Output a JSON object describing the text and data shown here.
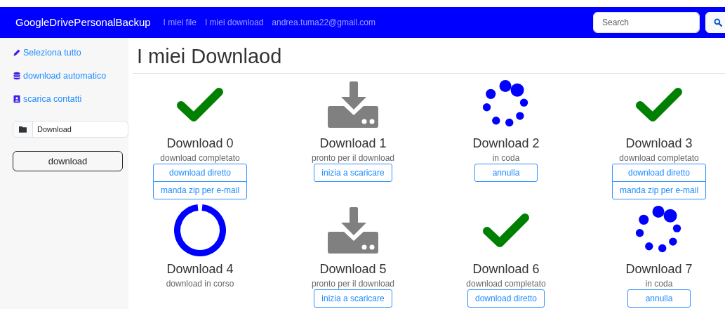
{
  "navbar": {
    "brand": "GoogleDrivePersonalBackup",
    "links": [
      "I miei file",
      "I miei download",
      "andrea.tuma22@gmail.com"
    ],
    "search": {
      "placeholder": "Search"
    }
  },
  "sidebar": {
    "links": [
      {
        "kind": "edit",
        "label": "Seleziona tutto"
      },
      {
        "kind": "database",
        "label": "download automatico"
      },
      {
        "kind": "contact",
        "label": "scarica contatti"
      }
    ],
    "folder_field": {
      "value": "Download"
    },
    "button": "download"
  },
  "title": "I miei Downlaod",
  "downloads": [
    {
      "kind": "completed",
      "name": "Download 0",
      "status": "download completato",
      "buttons": [
        "download diretto",
        "manda zip per e-mail"
      ]
    },
    {
      "kind": "ready",
      "name": "Download 1",
      "status": "pronto per il download",
      "buttons": [
        "inizia a scaricare"
      ]
    },
    {
      "kind": "queued",
      "name": "Download 2",
      "status": "in coda",
      "buttons": [
        "annulla"
      ]
    },
    {
      "kind": "completed",
      "name": "Download 3",
      "status": "download completato",
      "buttons": [
        "download diretto",
        "manda zip per e-mail"
      ]
    },
    {
      "kind": "in_progress",
      "name": "Download 4",
      "status": "download in corso"
    },
    {
      "kind": "ready",
      "name": "Download 5",
      "status": "pronto per il download",
      "buttons": [
        "inizia a scaricare"
      ]
    },
    {
      "kind": "completed",
      "name": "Download 6",
      "status": "download completato",
      "buttons": [
        "download diretto"
      ]
    },
    {
      "kind": "queued",
      "name": "Download 7",
      "status": "in coda",
      "buttons": [
        "annulla"
      ]
    }
  ]
}
